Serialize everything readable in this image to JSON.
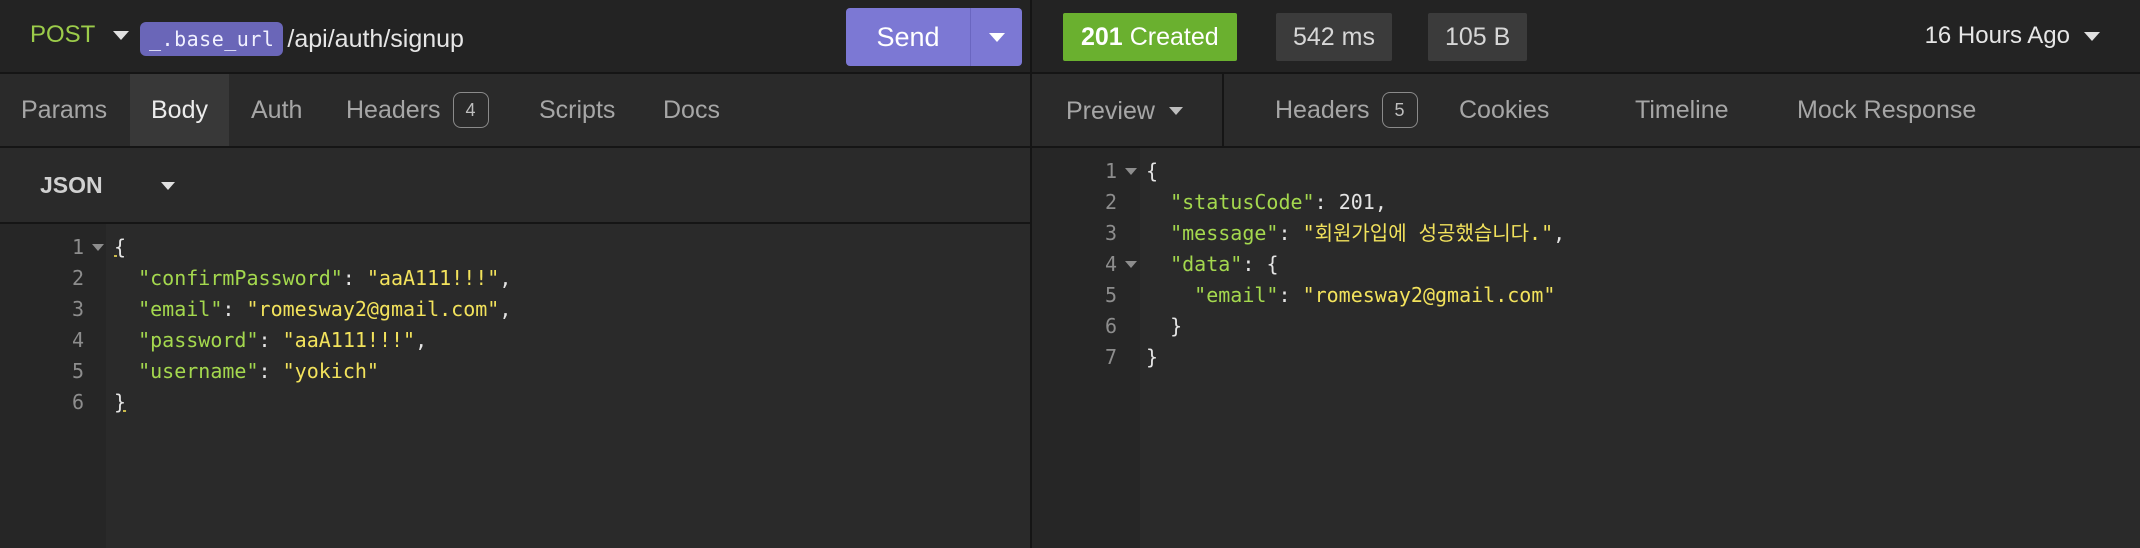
{
  "request": {
    "method": "POST",
    "url_variable": "_.base_url",
    "url_path": "/api/auth/signup",
    "send_label": "Send",
    "tabs": [
      {
        "label": "Params"
      },
      {
        "label": "Body"
      },
      {
        "label": "Auth"
      },
      {
        "label": "Headers",
        "count": "4"
      },
      {
        "label": "Scripts"
      },
      {
        "label": "Docs"
      }
    ],
    "body_type": "JSON",
    "body_lines": [
      {
        "n": "1",
        "t": "{"
      },
      {
        "n": "2",
        "k": "\"confirmPassword\"",
        "v": "\"aaA111!!!\"",
        "e": ","
      },
      {
        "n": "3",
        "k": "\"email\"",
        "v": "\"romesway2@gmail.com\"",
        "e": ","
      },
      {
        "n": "4",
        "k": "\"password\"",
        "v": "\"aaA111!!!\"",
        "e": ","
      },
      {
        "n": "5",
        "k": "\"username\"",
        "v": "\"yokich\"",
        "e": ""
      },
      {
        "n": "6",
        "t": "}"
      }
    ]
  },
  "response": {
    "status_code": "201",
    "status_text": "Created",
    "status_color": "#6ab02f",
    "time": "542 ms",
    "size": "105 B",
    "history": "16 Hours Ago",
    "view_mode": "Preview",
    "tabs": [
      {
        "label": "Headers",
        "count": "5"
      },
      {
        "label": "Cookies"
      },
      {
        "label": "Timeline"
      },
      {
        "label": "Mock Response"
      }
    ],
    "body_lines": [
      {
        "n": "1",
        "t": "{"
      },
      {
        "n": "2",
        "k": "\"statusCode\"",
        "num": "201",
        "e": ","
      },
      {
        "n": "3",
        "k": "\"message\"",
        "v": "\"회원가입에 성공했습니다.\"",
        "e": ","
      },
      {
        "n": "4",
        "k": "\"data\"",
        "t2": "{"
      },
      {
        "n": "5",
        "k": "\"email\"",
        "v": "\"romesway2@gmail.com\"",
        "e": ""
      },
      {
        "n": "6",
        "t": "}"
      },
      {
        "n": "7",
        "t": "}"
      }
    ]
  },
  "colors": {
    "accent": "#7c78d4",
    "method": "#9ccc4a",
    "json_key": "#a4d84e",
    "json_string": "#f2e25c"
  }
}
